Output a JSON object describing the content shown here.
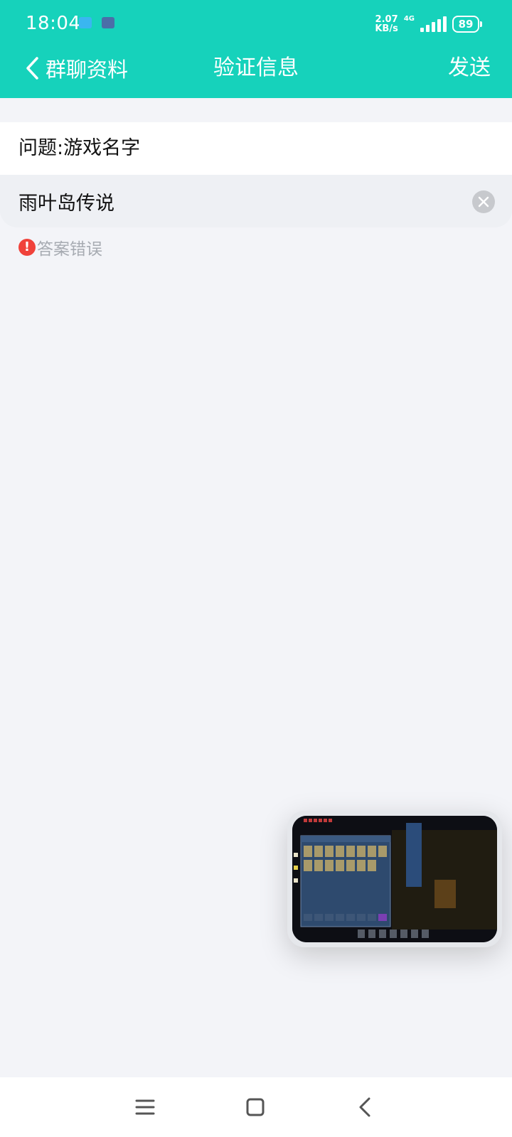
{
  "status_bar": {
    "time": "18:04",
    "net_speed_value": "2.07",
    "net_speed_unit": "KB/s",
    "network_type": "4G",
    "battery": "89"
  },
  "nav": {
    "back_label": "群聊资料",
    "title": "验证信息",
    "send_label": "发送"
  },
  "form": {
    "question": "问题:游戏名字",
    "answer_value": "雨叶岛传说",
    "error_message": "答案错误"
  },
  "colors": {
    "header_bg": "#16d2bb",
    "page_bg": "#f3f4f8",
    "error_red": "#f0423b"
  }
}
